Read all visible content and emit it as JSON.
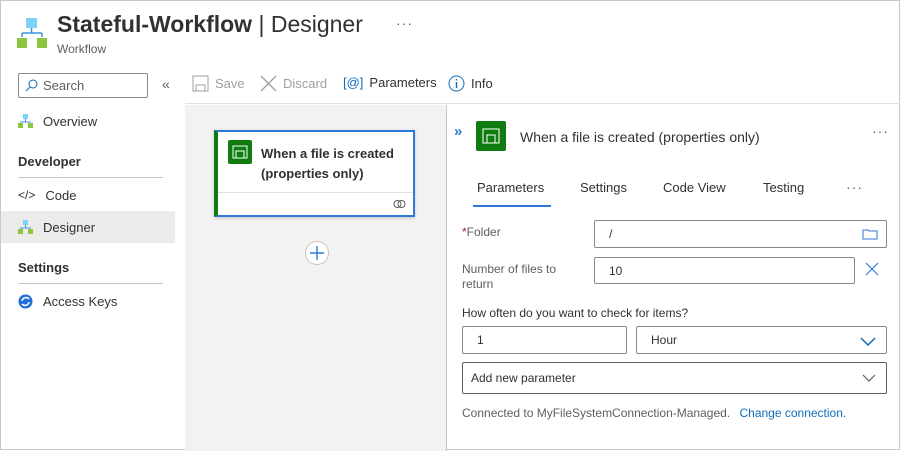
{
  "header": {
    "title_bold": "Stateful-Workflow",
    "title_rest": " | Designer",
    "subtitle": "Workflow",
    "more": "···"
  },
  "sidebar": {
    "search_placeholder": "Search",
    "collapse": "«",
    "overview": "Overview",
    "developer": "Developer",
    "code": "Code",
    "designer": "Designer",
    "settings": "Settings",
    "access_keys": "Access Keys"
  },
  "toolbar": {
    "save": "Save",
    "discard": "Discard",
    "parameters": "Parameters",
    "info": "Info"
  },
  "card": {
    "title": "When a file is created (properties only)"
  },
  "panel": {
    "title": "When a file is created (properties only)",
    "expand": "»",
    "more": "···",
    "tabs": [
      "Parameters",
      "Settings",
      "Code View",
      "Testing"
    ],
    "tabs_more": "···",
    "folder_label": "Folder",
    "required": "*",
    "folder_value": "/",
    "files_label": "Number of files to return",
    "files_value": "10",
    "often_label": "How often do you want to check for items?",
    "interval": "1",
    "frequency": "Hour",
    "add_param": "Add new parameter",
    "connected": "Connected to MyFileSystemConnection-Managed.",
    "change": "Change connection."
  }
}
